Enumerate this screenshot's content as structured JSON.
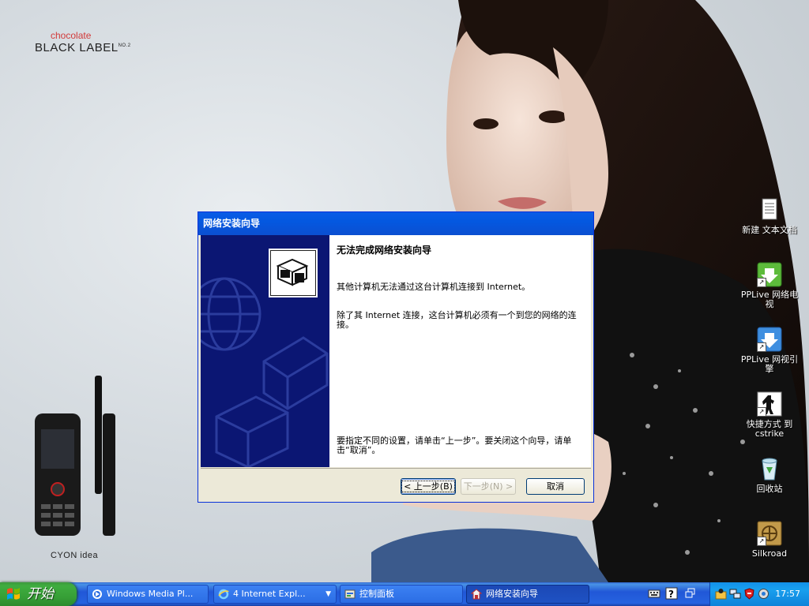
{
  "wallpaper": {
    "brand_small": "chocolate",
    "brand_big": "BLACK LABEL",
    "brand_sup": "NO.2",
    "phone_caption": "CYON idea"
  },
  "desktop_icons": [
    {
      "label": "新建 文本文档",
      "icon": "text-document-icon"
    },
    {
      "label": "PPLive 网络电视",
      "icon": "pplive-tv-icon"
    },
    {
      "label": "PPLive 网视引擎",
      "icon": "pplive-engine-icon"
    },
    {
      "label": "快捷方式 到 cstrike",
      "icon": "cstrike-icon"
    },
    {
      "label": "回收站",
      "icon": "recycle-bin-icon"
    },
    {
      "label": "Silkroad",
      "icon": "silkroad-icon"
    }
  ],
  "dialog": {
    "title": "网络安装向导",
    "heading": "无法完成网络安装向导",
    "para1": "其他计算机无法通过这台计算机连接到 Internet。",
    "para2": "除了其 Internet 连接，这台计算机必须有一个到您的网络的连接。",
    "para3": "要指定不同的设置，请单击“上一步”。要关闭这个向导，请单击“取消”。",
    "back_label": "< 上一步(B)",
    "next_label": "下一步(N) >",
    "cancel_label": "取消"
  },
  "taskbar": {
    "start_label": "开始",
    "tasks": [
      {
        "label": "Windows Media Pl...",
        "icon": "media-player-icon"
      },
      {
        "label": "4 Internet Expl...",
        "icon": "internet-explorer-icon"
      },
      {
        "label": "控制面板",
        "icon": "control-panel-icon"
      },
      {
        "label": "网络安装向导",
        "icon": "network-wizard-icon"
      }
    ],
    "clock": "17:57"
  },
  "colors": {
    "titlebar": "#0a5ce6",
    "sidebar": "#0b1673",
    "dialog_bg": "#ece9d8",
    "taskbar": "#2157d7",
    "start": "#37a037"
  }
}
